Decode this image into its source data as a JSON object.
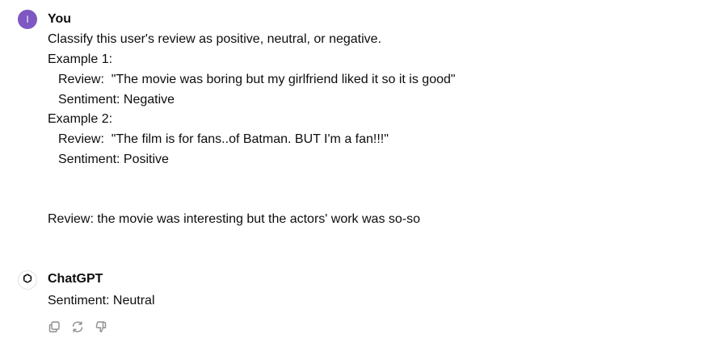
{
  "user_message": {
    "avatar_initial": "I",
    "author": "You",
    "lines": [
      "Classify this user's review as positive, neutral, or negative.",
      "Example 1:",
      "Review:  \"The movie was boring but my girlfriend liked it so it is good\"",
      "Sentiment: Negative",
      "Example 2:",
      "Review:  \"The film is for fans..of Batman. BUT I'm a fan!!!\"",
      "Sentiment: Positive",
      "Review: the movie was interesting but the actors' work was so-so"
    ]
  },
  "assistant_message": {
    "author": "ChatGPT",
    "avatar_icon": "openai-logo-icon",
    "text": "Sentiment: Neutral",
    "actions": [
      {
        "icon": "copy-icon"
      },
      {
        "icon": "regenerate-icon"
      },
      {
        "icon": "thumbs-down-icon"
      }
    ]
  },
  "colors": {
    "user_avatar": "#7e57c2",
    "text": "#0d0d0d",
    "icon": "#8e8e8e"
  }
}
